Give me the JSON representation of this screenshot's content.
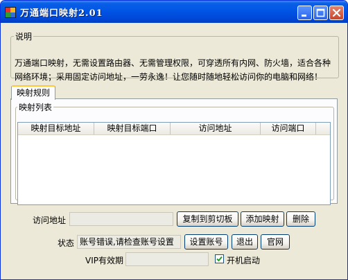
{
  "window": {
    "title": "万通端口映射2.01",
    "icon": "app-icon",
    "controls": [
      "minimize-icon",
      "maximize-icon",
      "close-icon"
    ],
    "accent": "#0055e5"
  },
  "description": {
    "legend": "说明",
    "text": "万通端口映射，无需设置路由器、无需管理权限，可穿透所有内网、防火墙，适合各种网络环境；采用固定访问地址，一劳永逸！让您随时随地轻松访问你的电脑和网络！"
  },
  "tab": {
    "label": "映射规则"
  },
  "mapping_list": {
    "legend": "映射列表",
    "columns": [
      "映射目标地址",
      "映射目标端口",
      "访问地址",
      "访问端口"
    ],
    "rows": []
  },
  "access": {
    "label": "访问地址",
    "value": "",
    "copy_button": "复制到剪切板",
    "add_button": "添加映射",
    "delete_button": "删除"
  },
  "status": {
    "label": "状态",
    "value": "账号错误,请检查账号设置",
    "set_account_button": "设置账号",
    "exit_button": "退出",
    "website_button": "官网"
  },
  "vip": {
    "label": "VIP有效期",
    "value": ""
  },
  "autostart": {
    "label": "开机启动",
    "checked": true
  }
}
